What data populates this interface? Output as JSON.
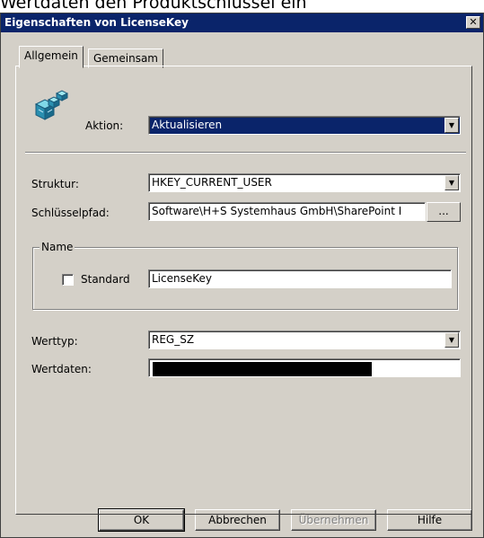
{
  "caption": "Wertdaten den Produktschlüssel ein",
  "window": {
    "title": "Eigenschaften von LicenseKey",
    "close_glyph": "✕"
  },
  "tabs": [
    {
      "label": "Allgemein"
    },
    {
      "label": "Gemeinsam"
    }
  ],
  "action": {
    "label": "Aktion:",
    "value": "Aktualisieren"
  },
  "structure": {
    "label": "Struktur:",
    "value": "HKEY_CURRENT_USER"
  },
  "key_path": {
    "label": "Schlüsselpfad:",
    "value": "Software\\H+S Systemhaus GmbH\\SharePoint I",
    "browse_label": "..."
  },
  "name_group": {
    "title": "Name",
    "default_label": "Standard",
    "value": "LicenseKey"
  },
  "value_type": {
    "label": "Werttyp:",
    "value": "REG_SZ"
  },
  "value_data": {
    "label": "Wertdaten:"
  },
  "buttons": {
    "ok": "OK",
    "cancel": "Abbrechen",
    "apply": "Übernehmen",
    "help": "Hilfe"
  },
  "icons": {
    "registry": "registry-cubes-icon",
    "dropdown": "chevron-down-icon"
  },
  "colors": {
    "title_bar": "#0a246a",
    "face": "#d4d0c8",
    "selection": "#0a246a"
  }
}
